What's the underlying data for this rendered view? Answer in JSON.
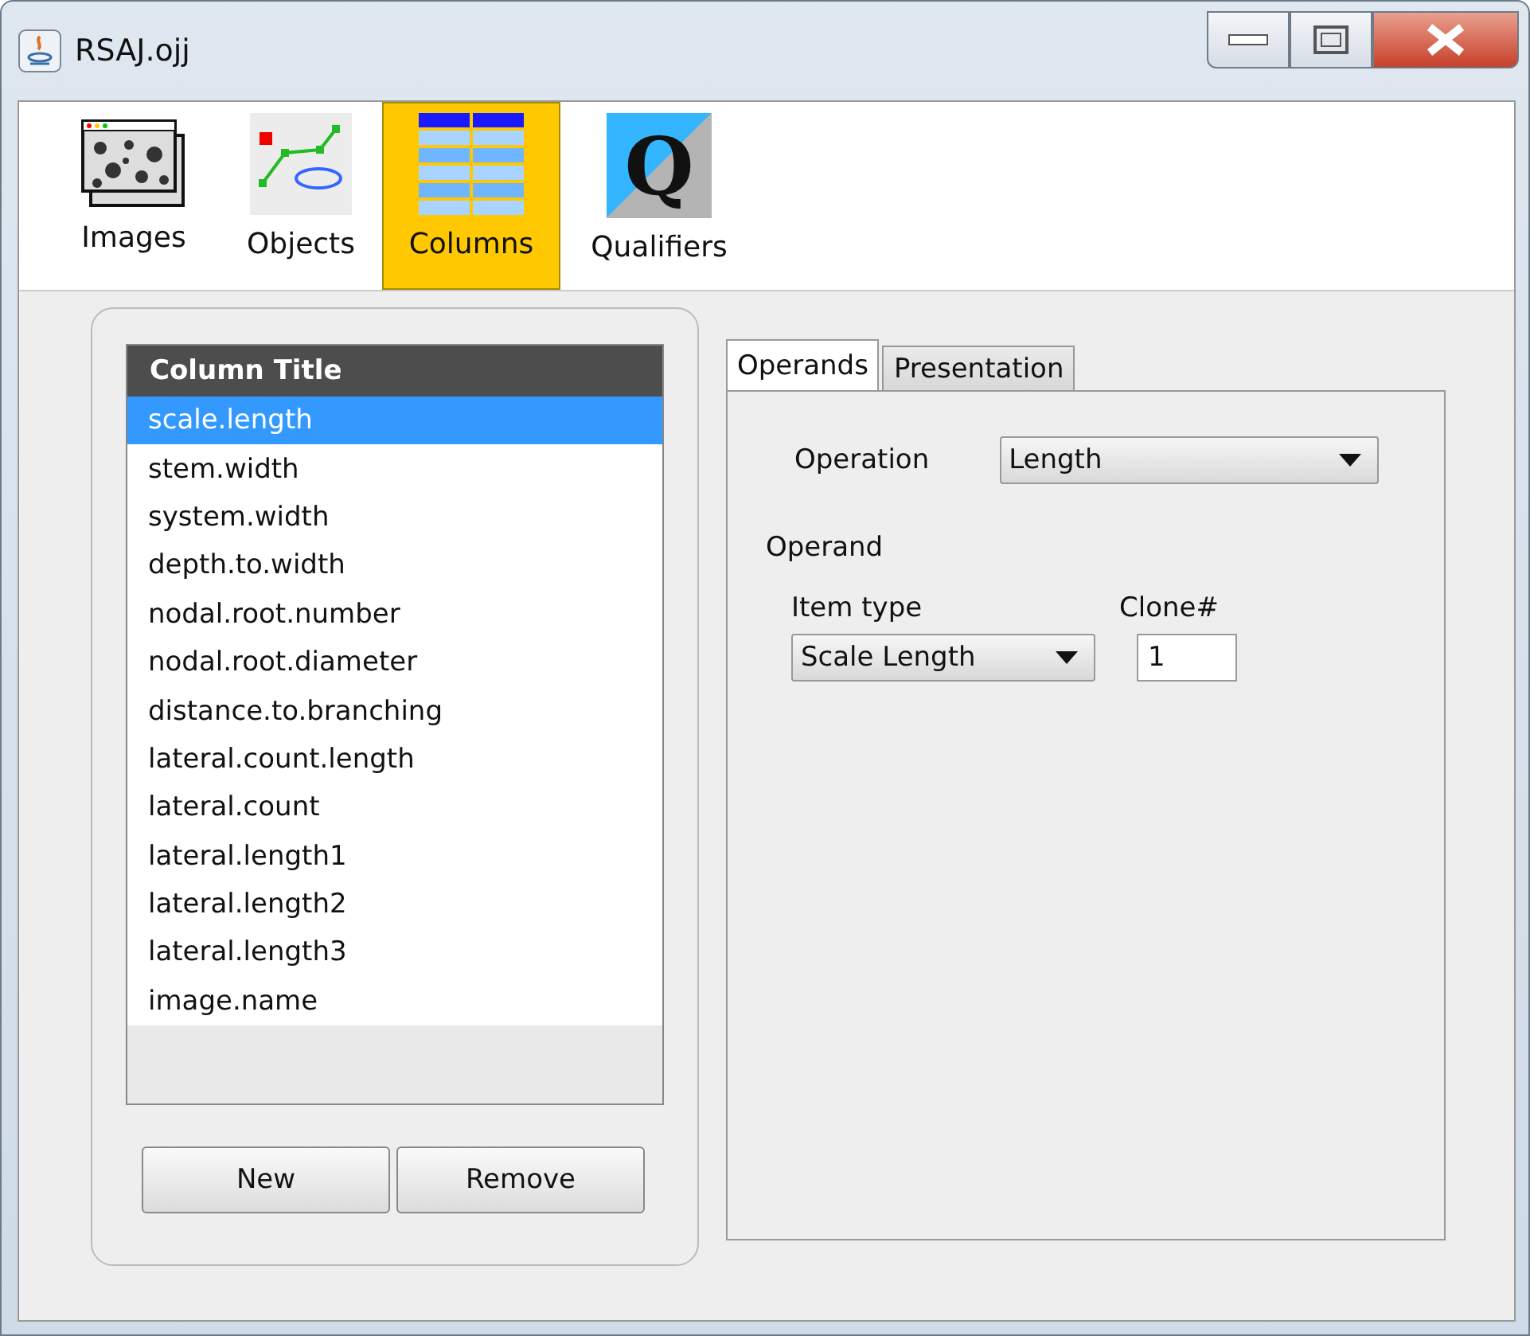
{
  "window": {
    "title": "RSAJ.ojj"
  },
  "toolbar": [
    {
      "kind": "images",
      "label": "Images",
      "selected": false
    },
    {
      "kind": "objects",
      "label": "Objects",
      "selected": false
    },
    {
      "kind": "columns",
      "label": "Columns",
      "selected": true
    },
    {
      "kind": "qualifiers",
      "label": "Qualifiers",
      "glyph": "Q",
      "selected": false
    }
  ],
  "column_list": {
    "header": "Column Title",
    "rows": [
      {
        "label": "scale.length",
        "selected": true
      },
      {
        "label": "stem.width",
        "selected": false
      },
      {
        "label": "system.width",
        "selected": false
      },
      {
        "label": "depth.to.width",
        "selected": false
      },
      {
        "label": "nodal.root.number",
        "selected": false
      },
      {
        "label": "nodal.root.diameter",
        "selected": false
      },
      {
        "label": "distance.to.branching",
        "selected": false
      },
      {
        "label": "lateral.count.length",
        "selected": false
      },
      {
        "label": "lateral.count",
        "selected": false
      },
      {
        "label": "lateral.length1",
        "selected": false
      },
      {
        "label": "lateral.length2",
        "selected": false
      },
      {
        "label": "lateral.length3",
        "selected": false
      },
      {
        "label": "image.name",
        "selected": false
      }
    ]
  },
  "buttons": [
    "New",
    "Remove"
  ],
  "tabs": [
    {
      "label": "Operands",
      "selected": true
    },
    {
      "label": "Presentation",
      "selected": false
    }
  ],
  "operation": {
    "label": "Operation",
    "value": "Length"
  },
  "operand": {
    "heading": "Operand",
    "item_type_label": "Item type",
    "item_type": "Scale Length",
    "clone_label": "Clone#",
    "clone": "1"
  }
}
